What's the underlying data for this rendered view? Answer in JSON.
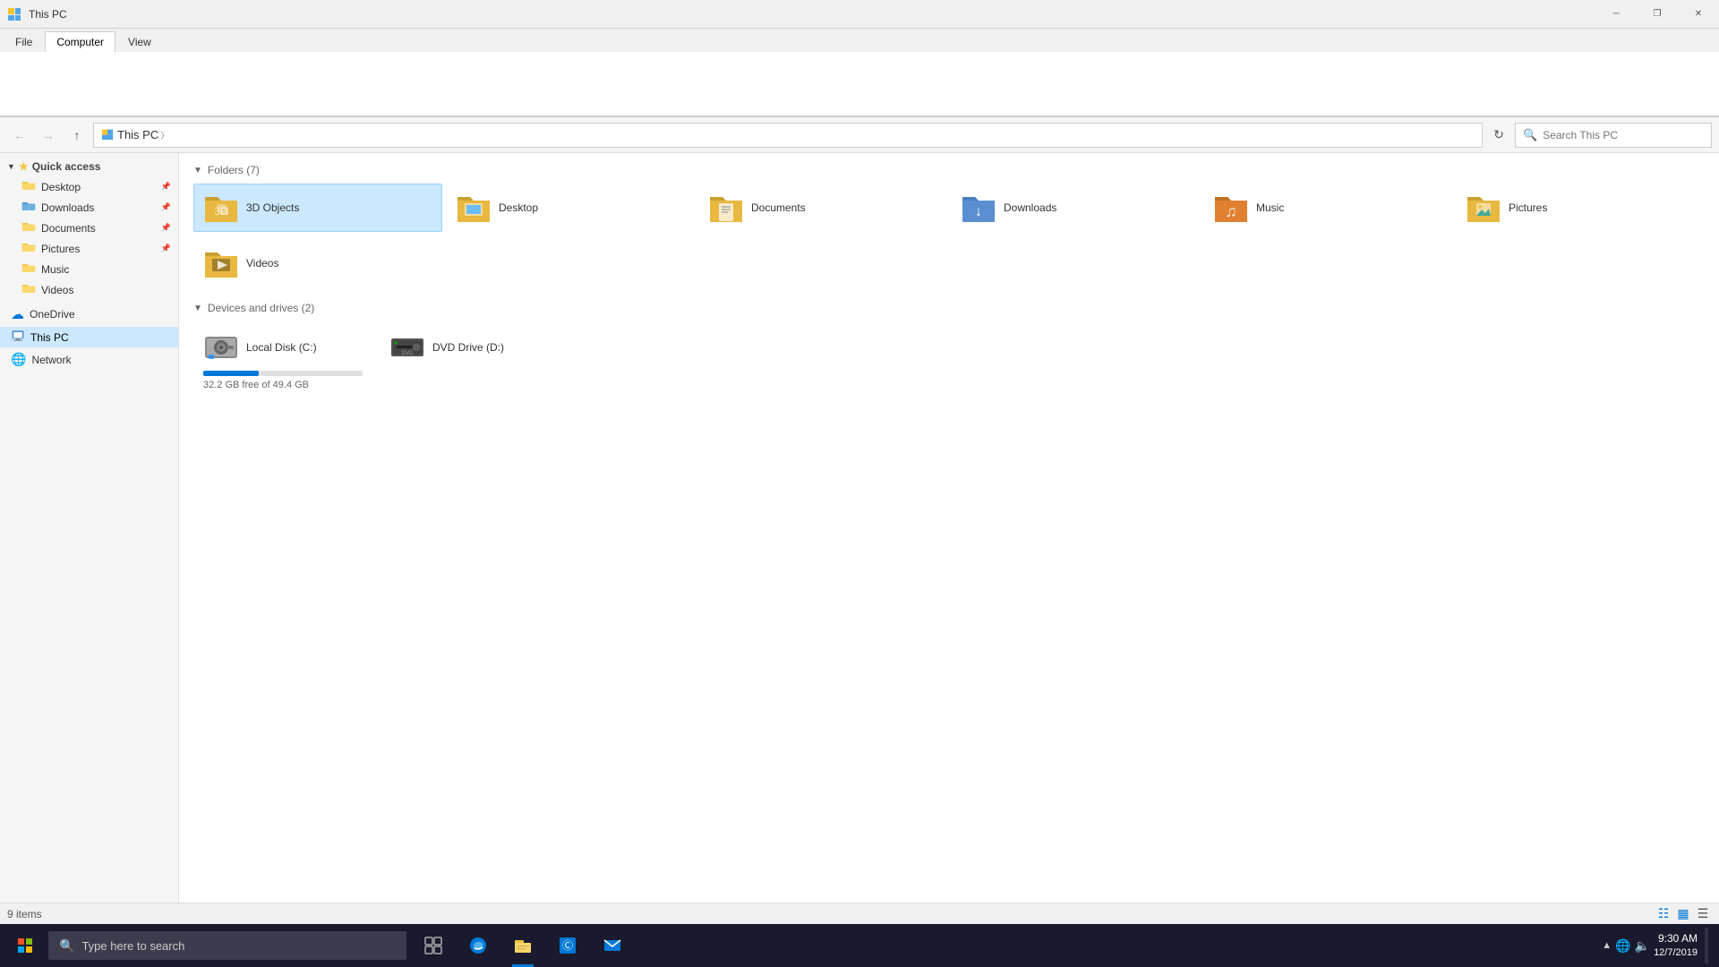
{
  "window": {
    "title": "This PC",
    "titlebar": {
      "minimize": "─",
      "restore": "❐",
      "close": "✕"
    }
  },
  "ribbon": {
    "tabs": [
      {
        "id": "file",
        "label": "File"
      },
      {
        "id": "computer",
        "label": "Computer"
      },
      {
        "id": "view",
        "label": "View"
      }
    ],
    "active_tab": "computer"
  },
  "addressbar": {
    "back_tooltip": "Back",
    "forward_tooltip": "Forward",
    "up_tooltip": "Up",
    "path": "This PC",
    "search_placeholder": "Search This PC",
    "search_label": "Search"
  },
  "sidebar": {
    "quick_access_label": "Quick access",
    "items": [
      {
        "id": "desktop",
        "label": "Desktop",
        "pinned": true
      },
      {
        "id": "downloads",
        "label": "Downloads",
        "pinned": true
      },
      {
        "id": "documents",
        "label": "Documents",
        "pinned": true
      },
      {
        "id": "pictures",
        "label": "Pictures",
        "pinned": true
      },
      {
        "id": "music",
        "label": "Music",
        "pinned": false
      },
      {
        "id": "videos",
        "label": "Videos",
        "pinned": false
      }
    ],
    "onedrive_label": "OneDrive",
    "thispc_label": "This PC",
    "network_label": "Network"
  },
  "content": {
    "folders_section_label": "Folders (7)",
    "devices_section_label": "Devices and drives (2)",
    "folders": [
      {
        "id": "3dobjects",
        "label": "3D Objects",
        "selected": true
      },
      {
        "id": "desktop",
        "label": "Desktop",
        "selected": false
      },
      {
        "id": "documents",
        "label": "Documents",
        "selected": false
      },
      {
        "id": "downloads",
        "label": "Downloads",
        "selected": false
      },
      {
        "id": "music",
        "label": "Music",
        "selected": false
      },
      {
        "id": "pictures",
        "label": "Pictures",
        "selected": false
      },
      {
        "id": "videos",
        "label": "Videos",
        "selected": false
      }
    ],
    "devices": [
      {
        "id": "local-c",
        "label": "Local Disk (C:)",
        "free": "32.2 GB free of 49.4 GB",
        "used_pct": 35,
        "type": "disk"
      },
      {
        "id": "dvd-d",
        "label": "DVD Drive (D:)",
        "free": "",
        "type": "dvd"
      }
    ]
  },
  "statusbar": {
    "items_count": "9 items"
  },
  "taskbar": {
    "search_placeholder": "Type here to search",
    "apps": [
      {
        "id": "search",
        "label": "Search"
      },
      {
        "id": "taskview",
        "label": "Task View"
      },
      {
        "id": "edge",
        "label": "Microsoft Edge"
      },
      {
        "id": "fileexplorer",
        "label": "File Explorer"
      },
      {
        "id": "store",
        "label": "Microsoft Store"
      },
      {
        "id": "mail",
        "label": "Mail"
      }
    ],
    "time": "9:30 AM",
    "date": "12/7/2019"
  }
}
